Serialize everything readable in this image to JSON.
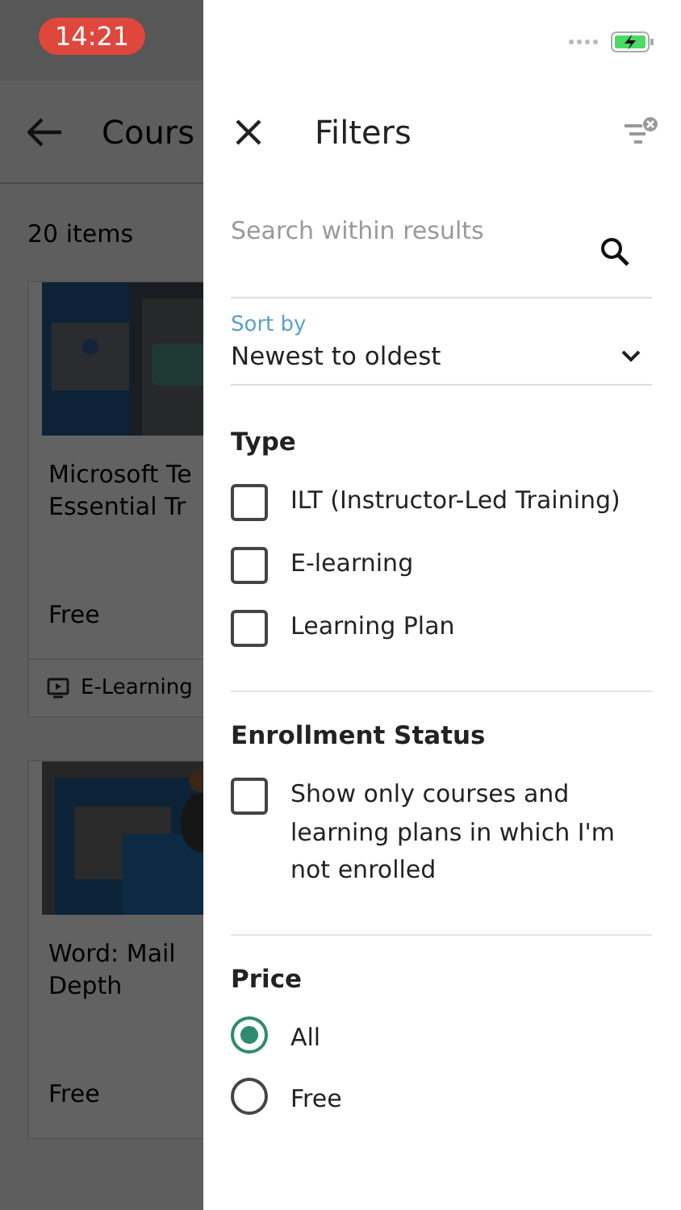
{
  "status_bar": {
    "time": "14:21"
  },
  "background_page": {
    "title": "Cours",
    "count": "20 items",
    "cards": [
      {
        "title_lines": [
          "Microsoft Te",
          "Essential Tr"
        ],
        "price": "Free",
        "type": "E-Learning",
        "image": {
          "kind": "picture"
        }
      },
      {
        "title_lines": [
          "Word: Mail",
          "Depth"
        ],
        "price": "Free",
        "image": {
          "kind": "picture"
        }
      }
    ]
  },
  "filters": {
    "title": "Filters",
    "search": {
      "placeholder": "Search within results"
    },
    "sort": {
      "label": "Sort by",
      "value": "Newest to oldest"
    },
    "sections": [
      {
        "title": "Type",
        "options": [
          {
            "kind": "checkbox",
            "label": "ILT (Instructor-Led Training)",
            "checked": false
          },
          {
            "kind": "checkbox",
            "label": "E-learning",
            "checked": false
          },
          {
            "kind": "checkbox",
            "label": "Learning Plan",
            "checked": false
          }
        ]
      },
      {
        "title": "Enrollment Status",
        "options": [
          {
            "kind": "checkbox",
            "label": "Show only courses and learning plans in which I'm not enrolled",
            "checked": false
          }
        ]
      },
      {
        "title": "Price",
        "options": [
          {
            "kind": "radio",
            "label": "All",
            "selected": true
          },
          {
            "kind": "radio",
            "label": "Free",
            "selected": false
          }
        ]
      }
    ]
  }
}
